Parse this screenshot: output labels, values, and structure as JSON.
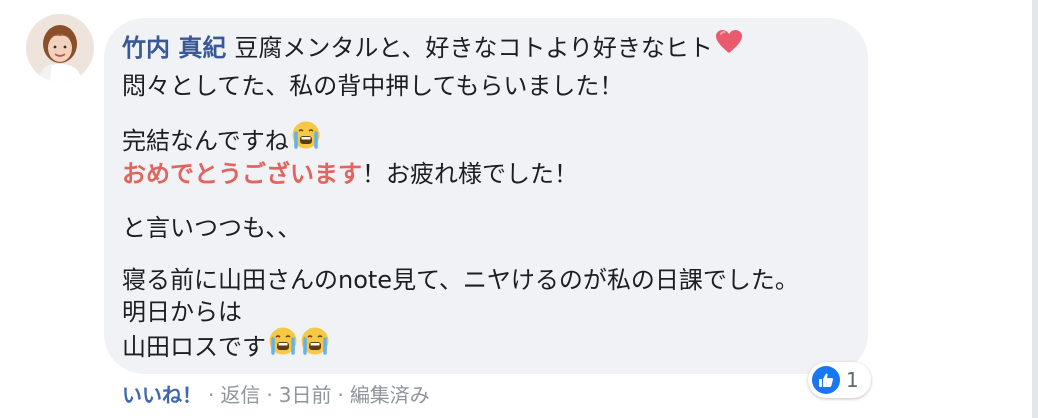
{
  "comment": {
    "author": "竹内 真紀",
    "lines": {
      "l1": "豆腐メンタルと、好きなコトより好きなヒト",
      "l2": "悶々としてた、私の背中押してもらいました！",
      "l3": "完結なんですね",
      "l4a": "おめでとうございます",
      "l4b": "！お疲れ様でした！",
      "l5": "と言いつつも、、",
      "l6": "寝る前に山田さんのnote見て、ニヤけるのが私の日課でした。",
      "l7": "明日からは",
      "l8": "山田ロスです"
    },
    "emojis": [
      "heart-emoji",
      "crying-face-emoji",
      "crying-face-emoji",
      "crying-face-emoji"
    ],
    "highlight_color": "#e0655f"
  },
  "reaction": {
    "type": "like",
    "count": "1",
    "color": "#1877f2"
  },
  "actions": {
    "like": "いいね！",
    "reply": "返信",
    "time": "3日前",
    "edited": "編集済み",
    "separator": "·"
  }
}
